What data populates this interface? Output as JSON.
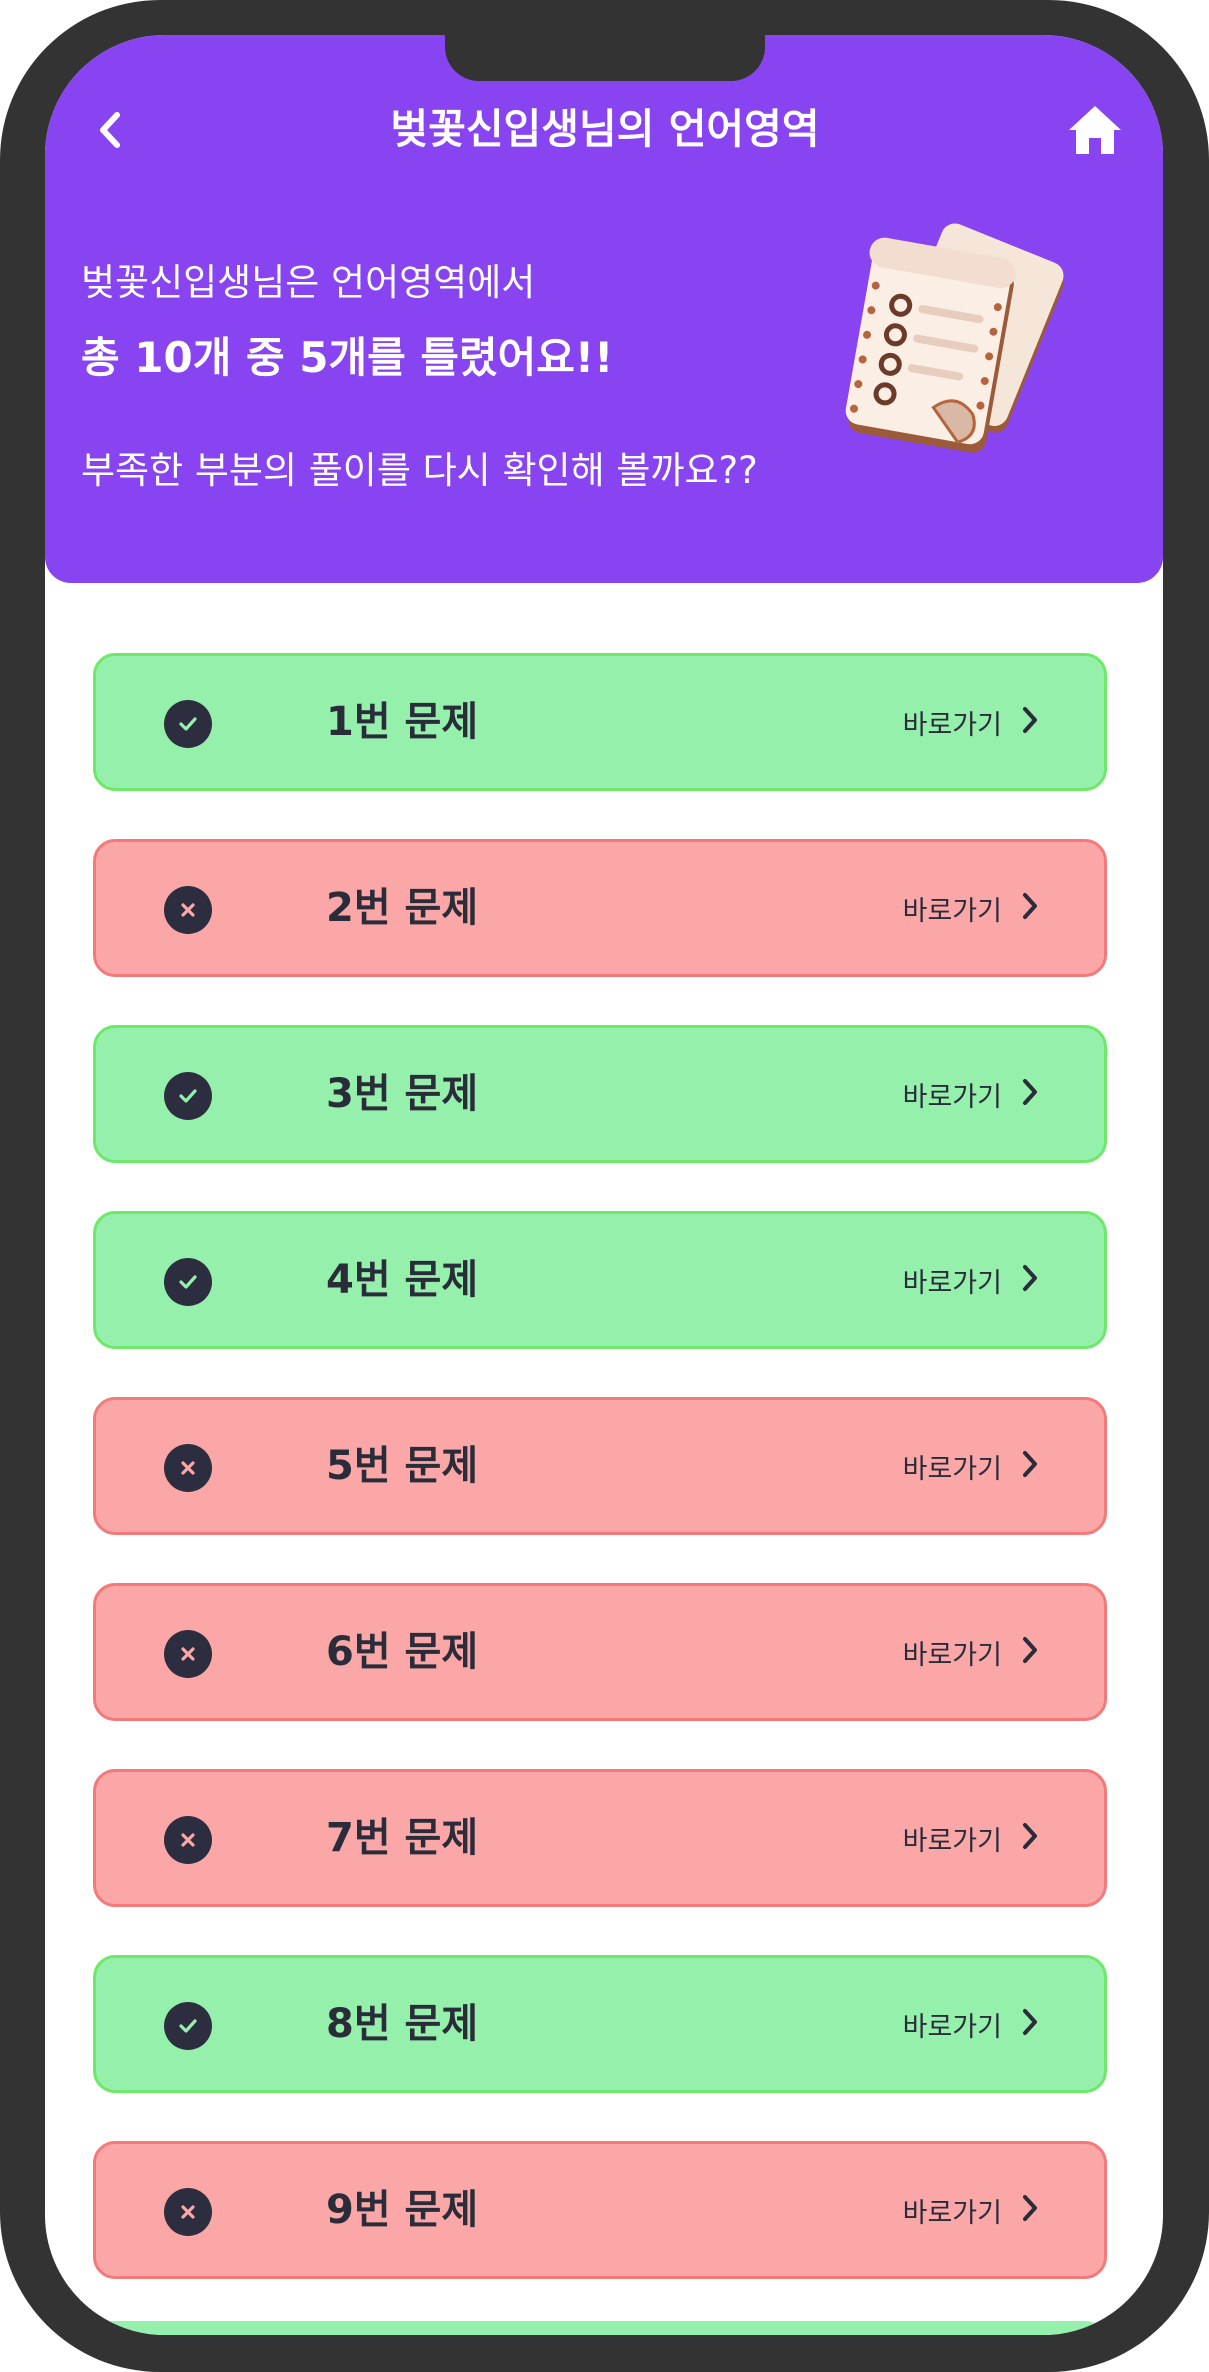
{
  "header": {
    "title": "벚꽃신입생님의 언어영역",
    "summary_line1": "벚꽃신입생님은 언어영역에서",
    "summary_line2": "총 10개 중 5개를 틀렸어요!!",
    "summary_line3": "부족한 부분의 풀이를 다시 확인해 볼까요??",
    "icons": {
      "back": "chevron-left-icon",
      "home": "home-icon",
      "illustration": "document-scroll-illustration"
    }
  },
  "colors": {
    "header_bg": "#8744f0",
    "correct_bg": "#94f0ab",
    "wrong_bg": "#fba7a7"
  },
  "questions": [
    {
      "label": "1번 문제",
      "status": "correct",
      "goto": "바로가기"
    },
    {
      "label": "2번 문제",
      "status": "wrong",
      "goto": "바로가기"
    },
    {
      "label": "3번 문제",
      "status": "correct",
      "goto": "바로가기"
    },
    {
      "label": "4번 문제",
      "status": "correct",
      "goto": "바로가기"
    },
    {
      "label": "5번 문제",
      "status": "wrong",
      "goto": "바로가기"
    },
    {
      "label": "6번 문제",
      "status": "wrong",
      "goto": "바로가기"
    },
    {
      "label": "7번 문제",
      "status": "wrong",
      "goto": "바로가기"
    },
    {
      "label": "8번 문제",
      "status": "correct",
      "goto": "바로가기"
    },
    {
      "label": "9번 문제",
      "status": "wrong",
      "goto": "바로가기"
    }
  ]
}
